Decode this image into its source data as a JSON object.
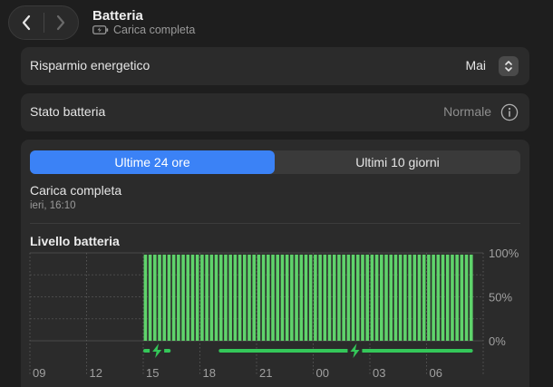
{
  "header": {
    "title": "Batteria",
    "subtitle": "Carica completa",
    "back_icon": "chevron-left-icon",
    "forward_icon": "chevron-right-icon",
    "status_icon": "battery-charging-icon"
  },
  "settings": {
    "power_saving": {
      "label": "Risparmio energetico",
      "value": "Mai"
    },
    "battery_health": {
      "label": "Stato batteria",
      "value": "Normale"
    }
  },
  "tabs": {
    "selected": "Ultime 24 ore",
    "other": "Ultimi 10 giorni"
  },
  "status": {
    "title": "Carica completa",
    "time": "ieri, 16:10"
  },
  "colors": {
    "accent": "#3b82f6",
    "battery_fill": "#5fd36b",
    "charging": "#34c759"
  },
  "chart_data": {
    "type": "bar",
    "title": "Livello batteria",
    "x_ticks": [
      "09",
      "12",
      "15",
      "18",
      "21",
      "00",
      "03",
      "06"
    ],
    "y_ticks": [
      "100%",
      "50%",
      "0%"
    ],
    "ylim": [
      0,
      100
    ],
    "grid": true,
    "bar_groups": [
      {
        "start_hour": 15,
        "end_hour": 19,
        "value": 98
      },
      {
        "start_hour": 19,
        "end_hour": 32.5,
        "value": 98
      }
    ],
    "charging_segments": [
      {
        "start_hour": 15,
        "end_hour": 16.5
      },
      {
        "start_hour": 19,
        "end_hour": 32.5
      }
    ]
  }
}
